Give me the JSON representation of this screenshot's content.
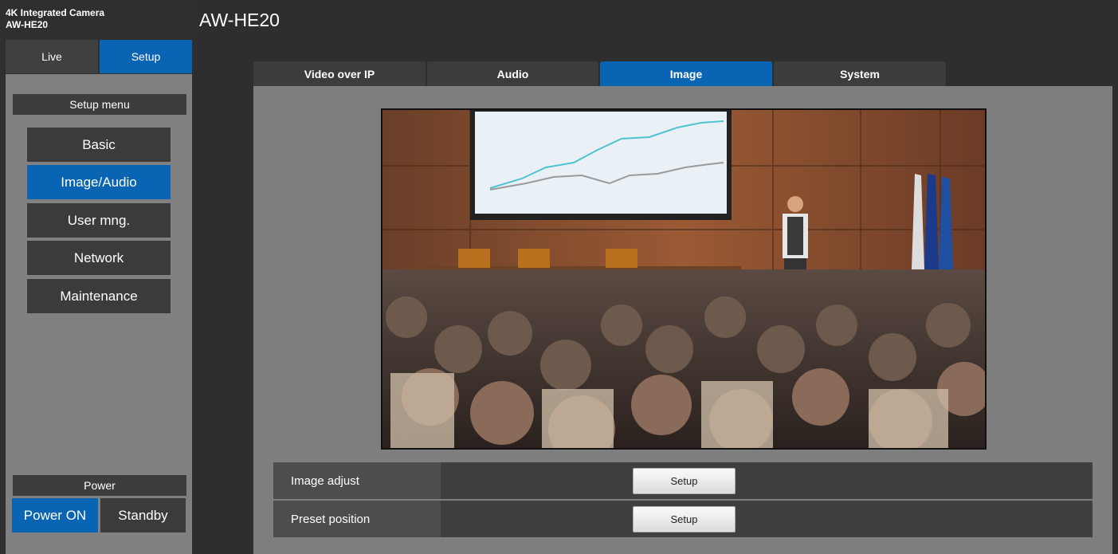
{
  "sidebar": {
    "product_line1": "4K Integrated Camera",
    "product_line2": "AW-HE20",
    "tab_live": "Live",
    "tab_setup": "Setup",
    "setup_menu_title": "Setup menu",
    "menu_items": [
      "Basic",
      "Image/Audio",
      "User mng.",
      "Network",
      "Maintenance"
    ],
    "active_menu_item": "Image/Audio",
    "power_title": "Power",
    "power_on": "Power ON",
    "standby": "Standby"
  },
  "header": {
    "title": "AW-HE20"
  },
  "tabs": [
    "Video over IP",
    "Audio",
    "Image",
    "System"
  ],
  "active_tab": "Image",
  "camera_view": {
    "icon": "live-camera-image"
  },
  "settings": [
    {
      "label": "Image adjust",
      "button": "Setup"
    },
    {
      "label": "Preset position",
      "button": "Setup"
    }
  ],
  "colors": {
    "accent": "#0a64b4",
    "background": "#2e2e2e",
    "panel": "#808080",
    "button_dark": "#3b3b3b"
  }
}
